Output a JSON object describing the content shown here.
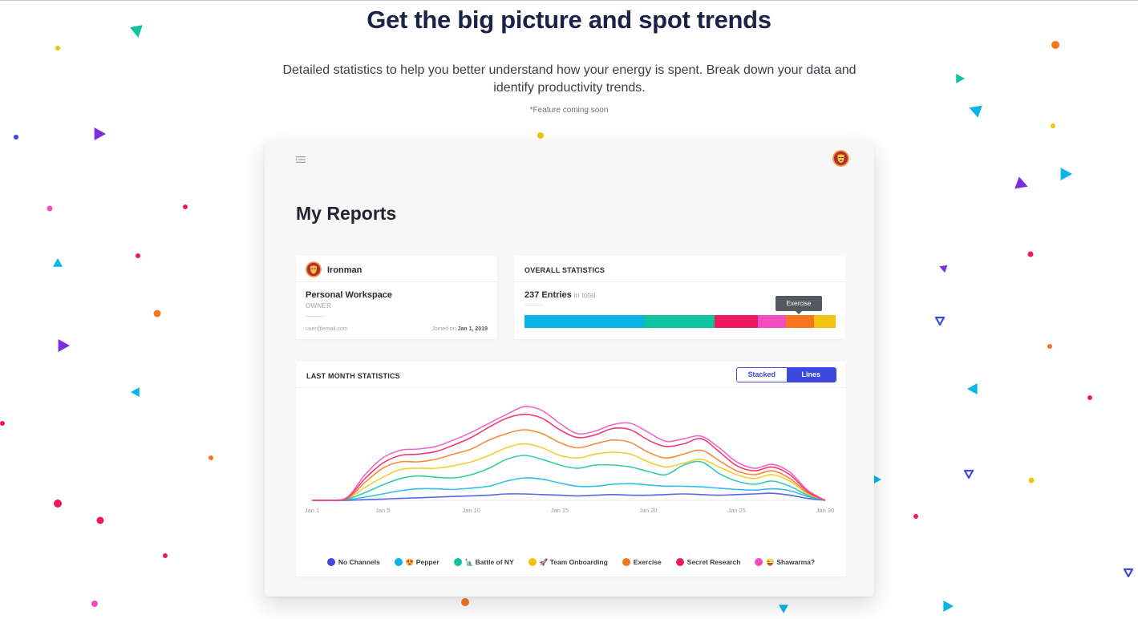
{
  "hero": {
    "title": "Get the big picture and spot trends",
    "description": "Detailed statistics to help you better understand how your energy is spent. Break down your data and identify productivity trends.",
    "note": "*Feature coming soon"
  },
  "app": {
    "title": "My Reports",
    "menu_icon": "menu-icon",
    "avatar_icon": "ironman-avatar-icon"
  },
  "profile": {
    "name": "Ironman",
    "workspace": "Personal Workspace",
    "role": "OWNER",
    "email": "user@email.com",
    "joined_label": "Joined on",
    "joined_date": "Jan 1, 2019"
  },
  "overall": {
    "title": "OVERALL STATISTICS",
    "entries": "237 Entries",
    "entries_suffix": "in total",
    "tooltip": "Exercise",
    "segments": [
      {
        "name": "Pepper",
        "fraction": 0.385,
        "color": "#0ab4e8"
      },
      {
        "name": "Battle of NY",
        "fraction": 0.225,
        "color": "#11c2a0"
      },
      {
        "name": "Secret Research",
        "fraction": 0.14,
        "color": "#f0185c"
      },
      {
        "name": "Shawarma?",
        "fraction": 0.09,
        "color": "#f04ec0"
      },
      {
        "name": "Exercise",
        "fraction": 0.09,
        "color": "#f7751c"
      },
      {
        "name": "Team Onboarding",
        "fraction": 0.07,
        "color": "#f2c40f"
      }
    ]
  },
  "month": {
    "title": "LAST MONTH STATISTICS",
    "toggle": {
      "stacked": "Stacked",
      "lines": "Lines",
      "active": "Lines"
    }
  },
  "chart_data": {
    "type": "line",
    "title": "LAST MONTH STATISTICS",
    "x": [
      1,
      2,
      3,
      4,
      5,
      6,
      7,
      8,
      9,
      10,
      11,
      12,
      13,
      14,
      15,
      16,
      17,
      18,
      19,
      20,
      21,
      22,
      23,
      24,
      25,
      26,
      27,
      28,
      29,
      30
    ],
    "xtick_labels": [
      "Jan 1",
      "Jan 5",
      "Jan 10",
      "Jan 15",
      "Jan 20",
      "Jan 25",
      "Jan 30"
    ],
    "xtick_days": [
      1,
      5,
      10,
      15,
      20,
      25,
      30
    ],
    "ylim": [
      0,
      160
    ],
    "grid": false,
    "legend_position": "bottom",
    "series": [
      {
        "name": "No Channels",
        "emoji": "",
        "color": "#3d48e0",
        "values": [
          0,
          0,
          0,
          1,
          2,
          3,
          4,
          5,
          6,
          7,
          8,
          10,
          10,
          9,
          8,
          7,
          8,
          9,
          8,
          8,
          9,
          10,
          9,
          8,
          9,
          10,
          11,
          8,
          3,
          0
        ]
      },
      {
        "name": "Pepper",
        "emoji": "😍",
        "color": "#0ab4e8",
        "values": [
          0,
          0,
          1,
          5,
          10,
          15,
          18,
          18,
          17,
          19,
          22,
          30,
          35,
          33,
          27,
          22,
          22,
          25,
          26,
          24,
          22,
          22,
          21,
          19,
          17,
          16,
          18,
          15,
          6,
          0
        ]
      },
      {
        "name": "Battle of NY",
        "emoji": "🗽",
        "color": "#11c2a0",
        "values": [
          0,
          0,
          2,
          12,
          24,
          34,
          38,
          36,
          35,
          40,
          50,
          64,
          70,
          64,
          55,
          50,
          55,
          55,
          52,
          45,
          40,
          55,
          60,
          42,
          30,
          25,
          30,
          22,
          8,
          0
        ]
      },
      {
        "name": "Team Onboarding",
        "emoji": "🚀",
        "color": "#f2c40f",
        "values": [
          0,
          0,
          3,
          20,
          36,
          48,
          50,
          50,
          54,
          60,
          70,
          82,
          88,
          82,
          70,
          66,
          72,
          75,
          72,
          60,
          52,
          58,
          64,
          52,
          40,
          34,
          40,
          30,
          10,
          0
        ]
      },
      {
        "name": "Exercise",
        "emoji": "",
        "color": "#f7751c",
        "values": [
          0,
          0,
          3,
          28,
          50,
          60,
          60,
          64,
          72,
          80,
          94,
          104,
          110,
          104,
          90,
          82,
          88,
          94,
          90,
          75,
          66,
          72,
          78,
          62,
          46,
          40,
          46,
          34,
          12,
          0
        ]
      },
      {
        "name": "Secret Research",
        "emoji": "",
        "color": "#f0185c",
        "values": [
          0,
          0,
          4,
          34,
          58,
          70,
          72,
          76,
          86,
          98,
          114,
          128,
          134,
          128,
          110,
          98,
          102,
          112,
          110,
          94,
          84,
          88,
          96,
          76,
          54,
          46,
          52,
          40,
          14,
          0
        ]
      },
      {
        "name": "Shawarma?",
        "emoji": "😜",
        "color": "#f04ec0",
        "values": [
          0,
          0,
          5,
          40,
          66,
          78,
          80,
          84,
          94,
          106,
          120,
          134,
          146,
          140,
          120,
          104,
          108,
          118,
          120,
          106,
          92,
          96,
          100,
          82,
          60,
          50,
          56,
          44,
          16,
          0
        ]
      }
    ]
  }
}
